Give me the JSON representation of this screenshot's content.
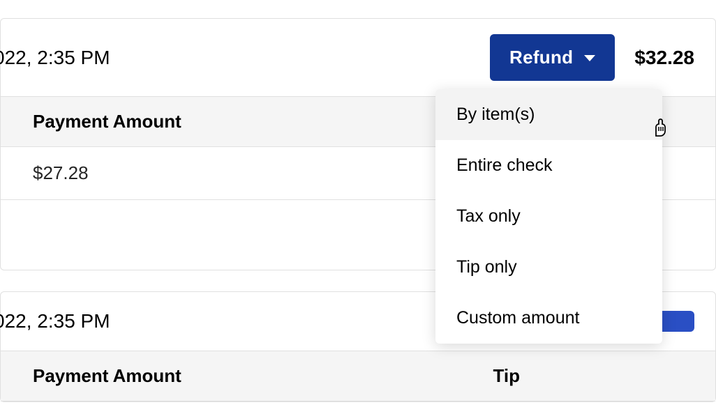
{
  "card1": {
    "timestamp": "022, 2:35 PM",
    "refund_label": "Refund",
    "total": "$32.28",
    "table": {
      "header": "Payment Amount",
      "value": "$27.28"
    }
  },
  "dropdown": {
    "items": [
      "By item(s)",
      "Entire check",
      "Tax only",
      "Tip only",
      "Custom amount"
    ]
  },
  "card2": {
    "timestamp": "022, 2:35 PM",
    "table": {
      "header1": "Payment Amount",
      "header2": "Tip"
    }
  }
}
